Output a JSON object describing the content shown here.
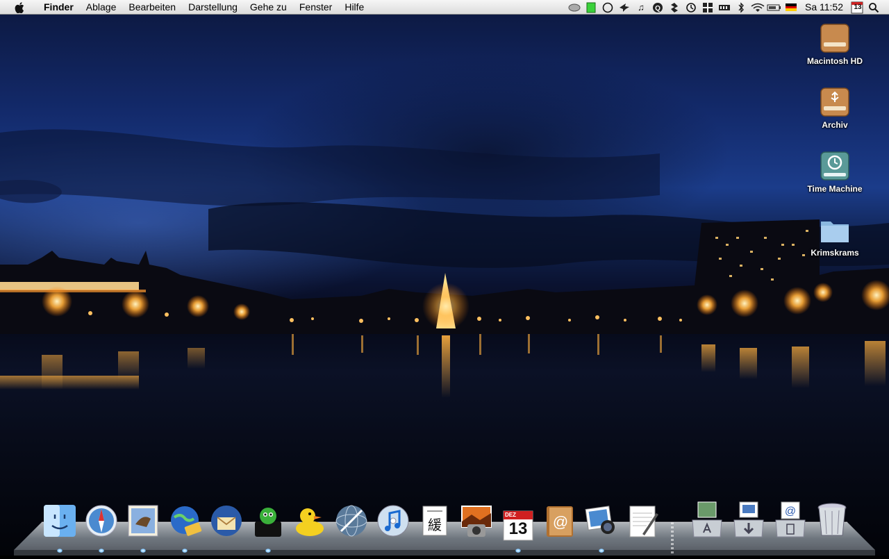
{
  "menubar": {
    "apple_icon": "apple-icon",
    "menus": [
      "Finder",
      "Ablage",
      "Bearbeiten",
      "Darstellung",
      "Gehe zu",
      "Fenster",
      "Hilfe"
    ],
    "status_icons": [
      "speech-bubble-icon",
      "battery-meter-icon",
      "chat-icon",
      "bird-icon",
      "music-note-icon",
      "q-icon",
      "dropbox-icon",
      "time-machine-icon",
      "spaces-icon",
      "memory-icon",
      "bluetooth-icon",
      "wifi-icon",
      "battery-icon",
      "german-flag-icon"
    ],
    "clock": "Sa 11:52",
    "calendar_day": "13",
    "spotlight_icon": "spotlight-icon"
  },
  "desktop": {
    "icons": [
      {
        "label": "Macintosh HD",
        "icon": "hard-drive-icon"
      },
      {
        "label": "Archiv",
        "icon": "usb-drive-icon"
      },
      {
        "label": "Time Machine",
        "icon": "time-machine-drive-icon"
      },
      {
        "label": "Krimskrams",
        "icon": "folder-icon"
      }
    ]
  },
  "dock": {
    "apps": [
      {
        "name": "Finder",
        "icon": "finder-icon",
        "running": true
      },
      {
        "name": "Safari",
        "icon": "safari-icon",
        "running": true
      },
      {
        "name": "Mail",
        "icon": "mail-icon",
        "running": true
      },
      {
        "name": "Network",
        "icon": "network-globe-icon",
        "running": true
      },
      {
        "name": "Thunderbird",
        "icon": "thunderbird-icon",
        "running": false
      },
      {
        "name": "Adium",
        "icon": "adium-icon",
        "running": true
      },
      {
        "name": "Cyberduck",
        "icon": "duck-icon",
        "running": false
      },
      {
        "name": "Web",
        "icon": "web-globe-icon",
        "running": false
      },
      {
        "name": "iTunes",
        "icon": "itunes-icon",
        "running": false
      },
      {
        "name": "Wörterbuch",
        "icon": "dictionary-icon",
        "running": false
      },
      {
        "name": "Photo Booth",
        "icon": "photo-booth-icon",
        "running": false
      },
      {
        "name": "iCal",
        "icon": "ical-icon",
        "running": true
      },
      {
        "name": "Adressbuch",
        "icon": "address-book-icon",
        "running": false
      },
      {
        "name": "iPhoto",
        "icon": "iphoto-icon",
        "running": true
      },
      {
        "name": "TextEdit",
        "icon": "textedit-icon",
        "running": false
      }
    ],
    "ical_month": "DEZ",
    "ical_day": "13",
    "stacks": [
      {
        "name": "Programme",
        "icon": "applications-stack-icon"
      },
      {
        "name": "Downloads",
        "icon": "downloads-stack-icon"
      },
      {
        "name": "Dokumente",
        "icon": "documents-stack-icon"
      }
    ],
    "trash": {
      "name": "Papierkorb",
      "icon": "trash-icon"
    }
  },
  "colors": {
    "menubar_bg": "#e6e6e6",
    "sky_top": "#0d1a44",
    "sky_mid": "#1b3c8a",
    "lights": "#ffb84d",
    "running_indicator": "#7fc6ff"
  }
}
